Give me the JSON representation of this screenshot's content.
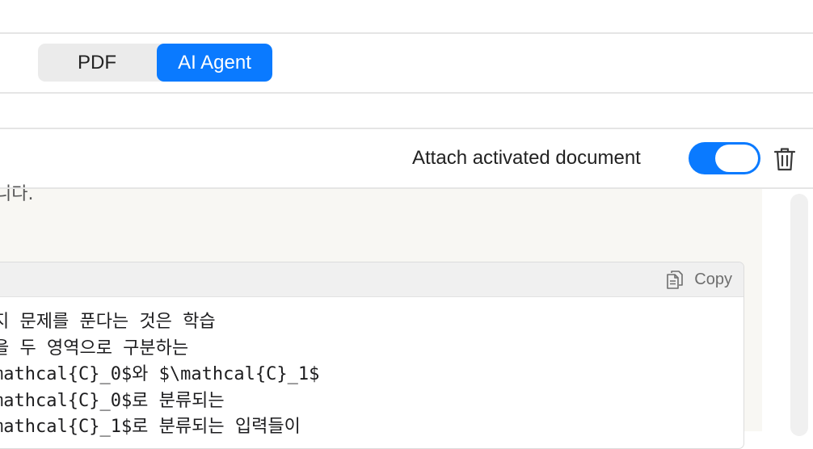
{
  "tabs": {
    "pdf_label": "PDF",
    "agent_label": "AI Agent"
  },
  "toolbar": {
    "attach_label": "Attach activated document",
    "attach_enabled": true
  },
  "message": {
    "visible_tail": "니다."
  },
  "code_block": {
    "copy_label": "Copy",
    "lines": [
      "지 문제를 푼다는 것은 학습",
      "을 두 영역으로 구분하는",
      "mathcal{C}_0$와 $\\mathcal{C}_1$",
      "mathcal{C}_0$로 분류되는",
      "mathcal{C}_1$로 분류되는 입력들이"
    ]
  },
  "colors": {
    "accent": "#0a7aff",
    "chat_bg": "#f8f7f3"
  },
  "icons": {
    "trash": "trash-icon",
    "copy": "copy-icon"
  }
}
